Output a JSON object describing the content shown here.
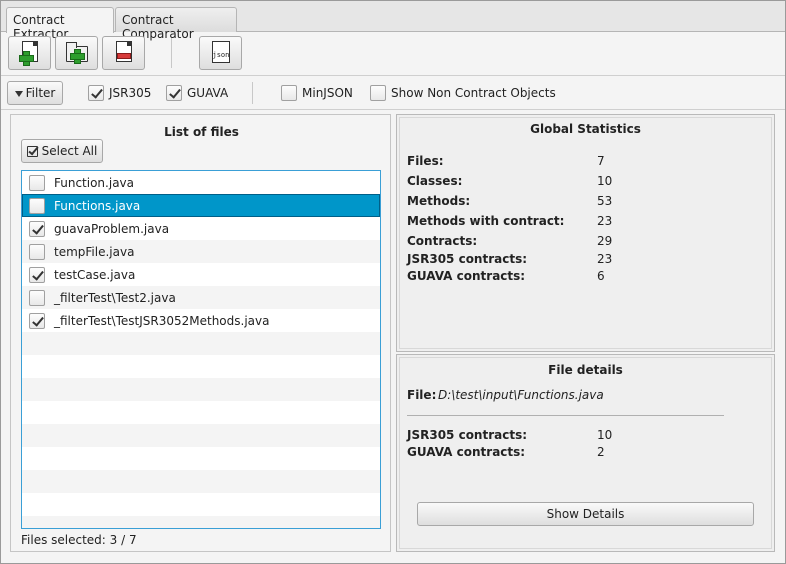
{
  "tabs": [
    {
      "label": "Contract Extractor",
      "active": true
    },
    {
      "label": "Contract Comparator",
      "active": false
    }
  ],
  "toolbar": {
    "buttons": [
      {
        "name": "add-file",
        "icon": "file-add-icon"
      },
      {
        "name": "open-folder",
        "icon": "folder-add-icon"
      },
      {
        "name": "remove-file",
        "icon": "file-remove-icon"
      },
      {
        "name": "export-json",
        "icon": "json-file-icon",
        "icon_text": "json"
      }
    ]
  },
  "filterbar": {
    "filter_label": "Filter",
    "options": [
      {
        "label": "JSR305",
        "checked": true
      },
      {
        "label": "GUAVA",
        "checked": true
      },
      {
        "label": "MinJSON",
        "checked": false
      },
      {
        "label": "Show Non Contract Objects",
        "checked": false
      }
    ]
  },
  "files_panel": {
    "title": "List of files",
    "select_all_label": "Select All",
    "files": [
      {
        "name": "Function.java",
        "checked": false,
        "selected": false
      },
      {
        "name": "Functions.java",
        "checked": false,
        "selected": true
      },
      {
        "name": "guavaProblem.java",
        "checked": true,
        "selected": false
      },
      {
        "name": "tempFile.java",
        "checked": false,
        "selected": false
      },
      {
        "name": "testCase.java",
        "checked": true,
        "selected": false
      },
      {
        "name": "_filterTest\\Test2.java",
        "checked": false,
        "selected": false
      },
      {
        "name": "_filterTest\\TestJSR3052Methods.java",
        "checked": true,
        "selected": false
      }
    ],
    "status": "Files selected: 3 / 7"
  },
  "global_stats": {
    "title": "Global Statistics",
    "rows": [
      {
        "label": "Files:",
        "value": "7"
      },
      {
        "label": "Classes:",
        "value": "10"
      },
      {
        "label": "Methods:",
        "value": "53"
      },
      {
        "label": "Methods with contract:",
        "value": "23"
      },
      {
        "label": "Contracts:",
        "value": "29"
      },
      {
        "label": "JSR305 contracts:",
        "value": "23"
      },
      {
        "label": "GUAVA contracts:",
        "value": "6"
      }
    ]
  },
  "file_details": {
    "title": "File details",
    "file_label": "File:",
    "file_path": "D:\\test\\input\\Functions.java",
    "rows": [
      {
        "label": "JSR305 contracts:",
        "value": "10"
      },
      {
        "label": "GUAVA contracts:",
        "value": "2"
      }
    ],
    "show_details_label": "Show Details"
  }
}
